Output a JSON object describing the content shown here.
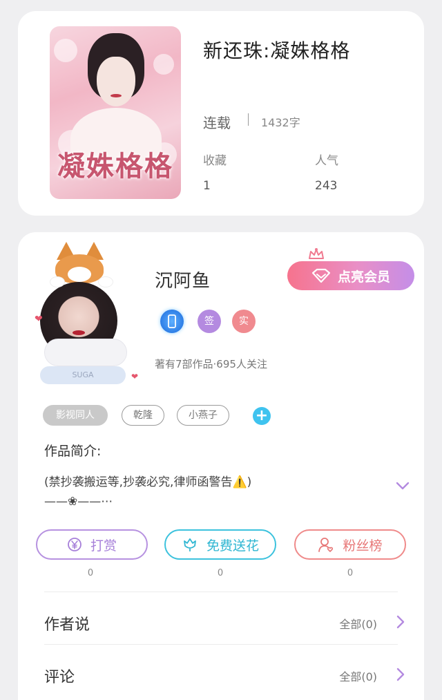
{
  "book": {
    "title": "新还珠:凝姝格格",
    "cover_title": "凝姝格格",
    "status": "连载",
    "word_count": "1432字",
    "stats": [
      {
        "label": "收藏",
        "value": "1"
      },
      {
        "label": "人气",
        "value": "243"
      }
    ]
  },
  "author": {
    "name": "沉阿鱼",
    "vip_label": "点亮会员",
    "avatar_badge": "SUGA",
    "badges": [
      {
        "text": "",
        "color": "#3f8ff0",
        "icon": "phone-badge-icon"
      },
      {
        "text": "签",
        "color": "#b48ae0",
        "icon": "signed-badge-icon"
      },
      {
        "text": "实",
        "color": "#f08a8f",
        "icon": "verified-badge-icon"
      }
    ],
    "meta": "著有7部作品·695人关注",
    "tags": [
      "影视同人",
      "乾隆",
      "小燕子"
    ],
    "add_tag": "+"
  },
  "intro": {
    "title": "作品简介:",
    "line1": "(禁抄袭搬运等,抄袭必究,律师函警告⚠️)",
    "line2": "——❀——⋯"
  },
  "actions": [
    {
      "label": "打赏",
      "icon": "yen-icon",
      "count": "0",
      "color": "#b691e0"
    },
    {
      "label": "免费送花",
      "icon": "flower-icon",
      "count": "0",
      "color": "#3cc2dd"
    },
    {
      "label": "粉丝榜",
      "icon": "fans-icon",
      "count": "0",
      "color": "#ef8a8a"
    }
  ],
  "rows": [
    {
      "label": "作者说",
      "value": "全部(0)"
    },
    {
      "label": "评论",
      "value": "全部(0)"
    }
  ],
  "colors": {
    "background": "#efeff1",
    "vip_gradient_start": "#f6738d",
    "vip_gradient_end": "#c48ee8",
    "add_tag": "#3fc3ef",
    "chevron": "#b48ae0"
  }
}
